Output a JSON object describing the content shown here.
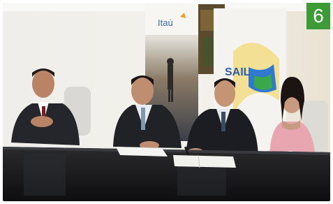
{
  "badge": {
    "number": "6",
    "color": "#3d9b35"
  },
  "banner_left": {
    "brand_text": "Itaú"
  },
  "banner_right": {
    "brand_text": "SAIL"
  },
  "colors": {
    "table": "#1a1a1a",
    "wall": "#e8e6e1"
  }
}
